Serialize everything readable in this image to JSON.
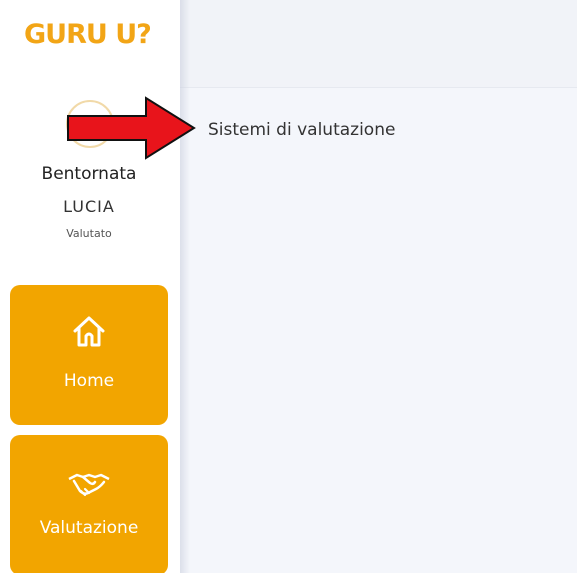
{
  "brand": {
    "logo_text": "GURU U?",
    "accent": "#f2a500"
  },
  "user": {
    "greeting": "Bentornata",
    "name": "LUCIA",
    "role": "Valutato"
  },
  "sidebar": {
    "items": [
      {
        "label": "Home",
        "icon": "home-icon"
      },
      {
        "label": "Valutazione",
        "icon": "handshake-icon"
      }
    ]
  },
  "main": {
    "heading": "Sistemi di valutazione",
    "background": "#f4f6fb"
  },
  "annotation": {
    "arrow_color": "#e8141b"
  }
}
